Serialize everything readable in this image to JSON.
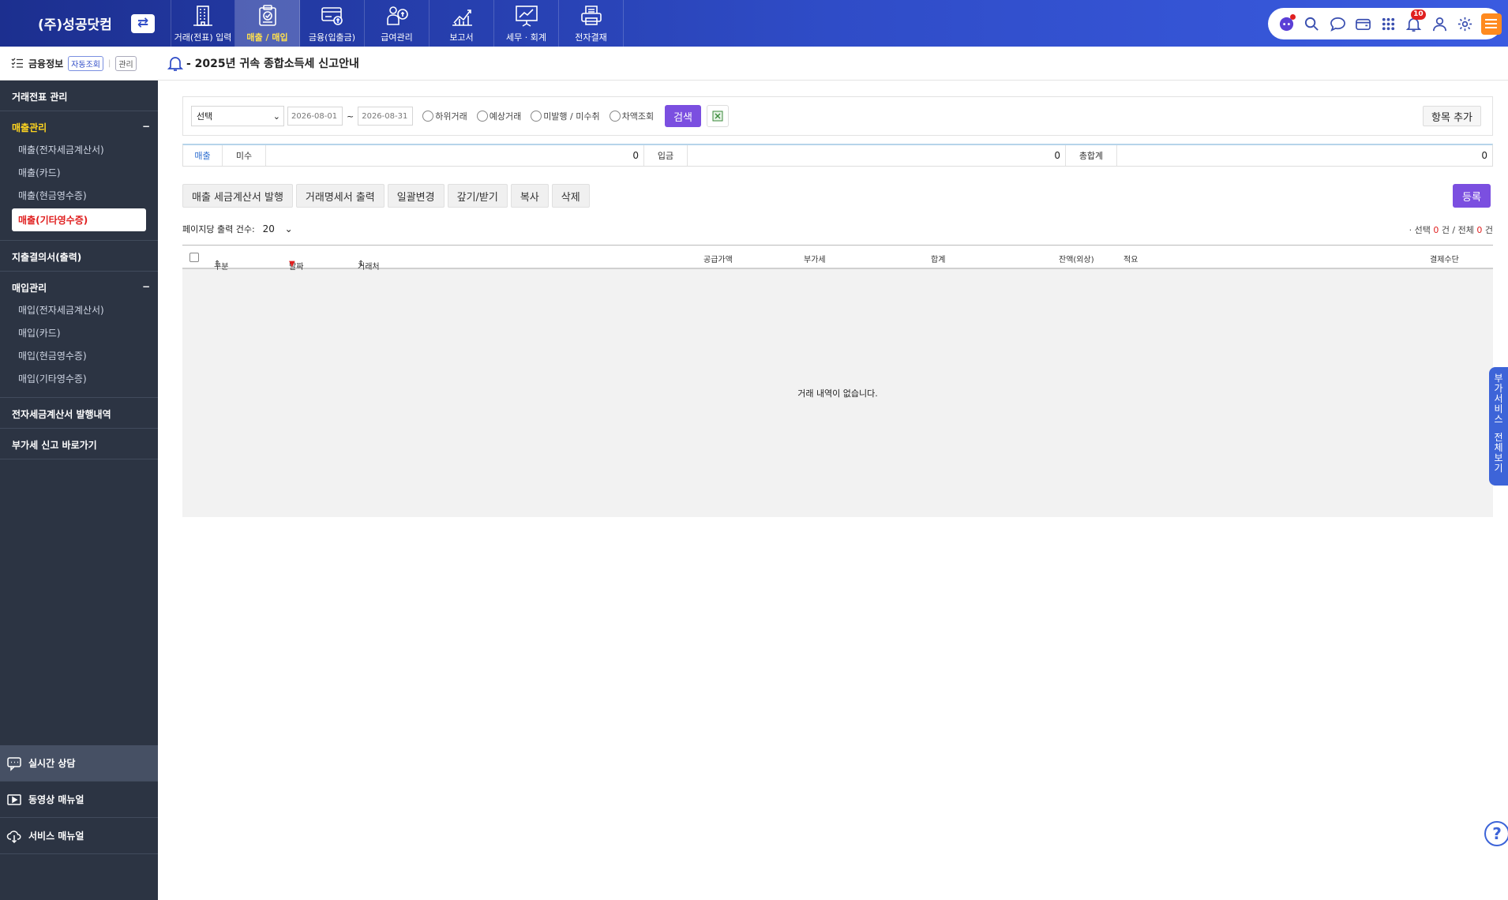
{
  "header": {
    "company": "(주)성공닷컴",
    "nav": [
      {
        "label": "거래(전표) 입력",
        "icon": "building-icon"
      },
      {
        "label": "매출 / 매입",
        "icon": "clipboard-check-icon"
      },
      {
        "label": "금융(입출금)",
        "icon": "bank-card-icon"
      },
      {
        "label": "급여관리",
        "icon": "payroll-icon"
      },
      {
        "label": "보고서",
        "icon": "chart-report-icon"
      },
      {
        "label": "세무 · 회계",
        "icon": "presentation-icon"
      },
      {
        "label": "전자결재",
        "icon": "printer-icon"
      }
    ],
    "notification_count": "10"
  },
  "sidebar": {
    "finance_label": "금융정보",
    "auto_query": "자동조회",
    "manage": "관리",
    "sections": [
      {
        "title": "거래전표 관리"
      },
      {
        "title": "매출관리",
        "items": [
          "매출(전자세금계산서)",
          "매출(카드)",
          "매출(현금영수증)",
          "매출(기타영수증)"
        ]
      },
      {
        "title": "지출결의서(출력)"
      },
      {
        "title": "매입관리",
        "items": [
          "매입(전자세금계산서)",
          "매입(카드)",
          "매입(현금영수증)",
          "매입(기타영수증)"
        ]
      },
      {
        "title": "전자세금계산서 발행내역"
      },
      {
        "title": "부가세 신고 바로가기"
      }
    ],
    "bottom": [
      "실시간 상담",
      "동영상 매뉴얼",
      "서비스 매뉴얼"
    ]
  },
  "main": {
    "notice": "- 2025년 귀속 종합소득세 신고안내",
    "filter": {
      "select": "선택",
      "date_from": "2026-08-01",
      "date_to": "2026-08-31",
      "tilde": "~",
      "radios": [
        "하위거래",
        "예상거래",
        "미발행 / 미수취",
        "차액조회"
      ],
      "search": "검색",
      "add_column": "항목 추가"
    },
    "summary": {
      "sales": "매출",
      "unpaid": "미수",
      "unpaid_value": "0",
      "deposit": "입금",
      "deposit_value": "0",
      "total": "총합계",
      "total_value": "0"
    },
    "actions": [
      "매출 세금계산서 발행",
      "거래명세서 출력",
      "일괄변경",
      "갚기/받기",
      "복사",
      "삭제"
    ],
    "register": "등록",
    "per_page_label": "페이지당 출력 건수:",
    "per_page_value": "20",
    "count": {
      "prefix": "· 선택",
      "selected": "0",
      "mid": "건 / 전체",
      "total": "0",
      "suffix": "건"
    },
    "columns": [
      "구분",
      "날짜",
      "거래처",
      "공급가액",
      "부가세",
      "합계",
      "잔액(외상)",
      "적요",
      "결제수단"
    ],
    "empty_message": "거래 내역이 없습니다."
  },
  "side_tab": [
    "부",
    "가",
    "서",
    "비",
    "스",
    "",
    "전",
    "체",
    "보",
    "기"
  ],
  "help": "?"
}
